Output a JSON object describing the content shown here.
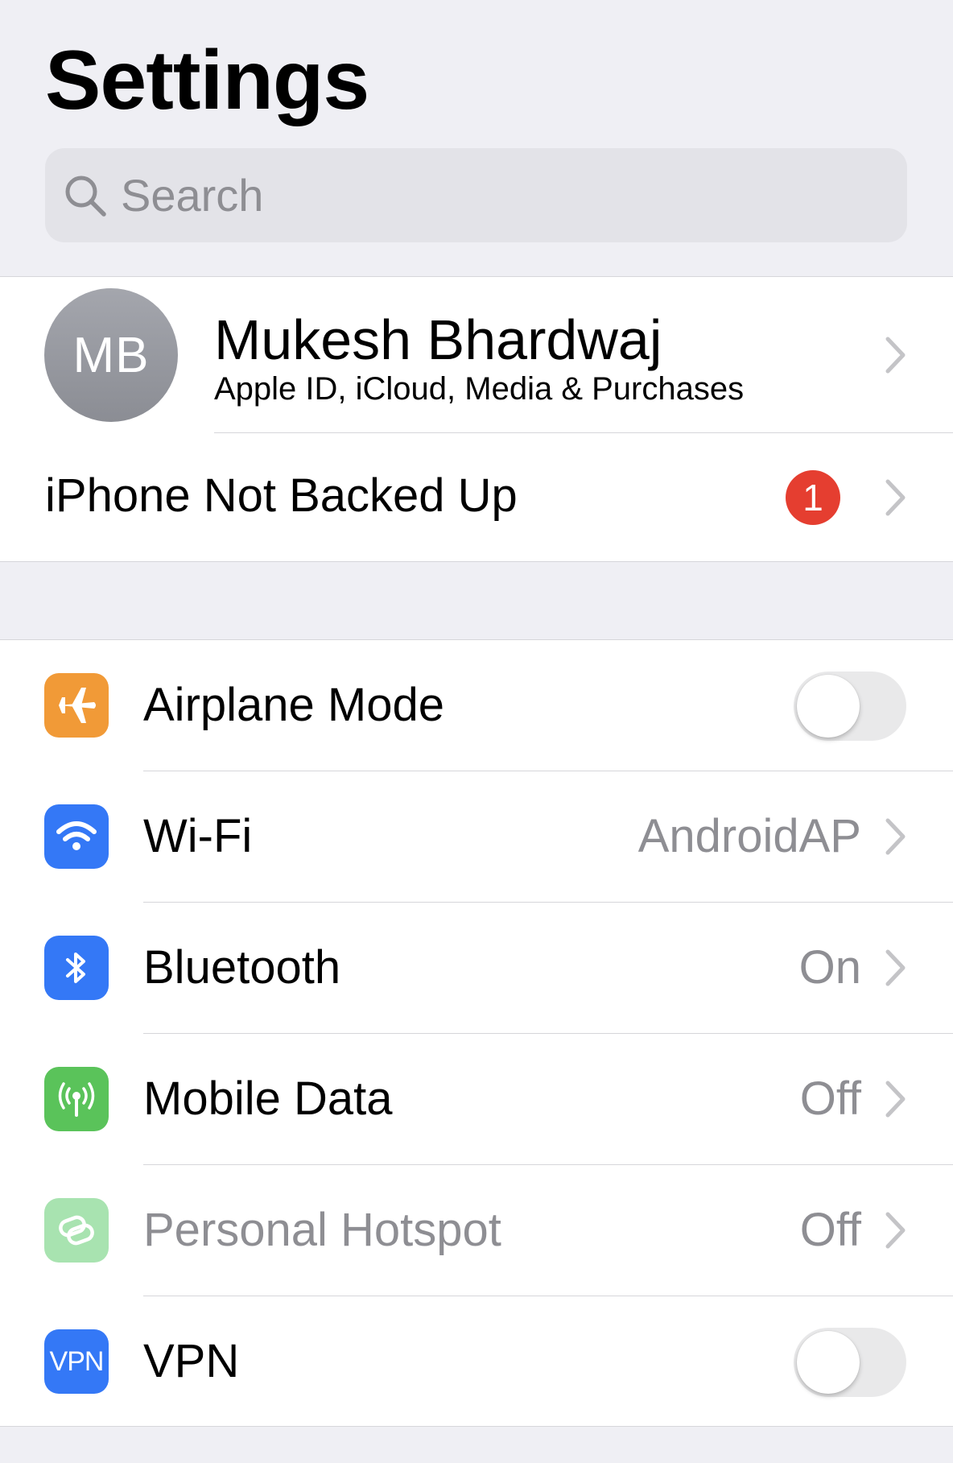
{
  "page": {
    "title": "Settings"
  },
  "search": {
    "placeholder": "Search"
  },
  "profile": {
    "initials": "MB",
    "name": "Mukesh Bhardwaj",
    "subtitle": "Apple ID, iCloud, Media & Purchases"
  },
  "backup": {
    "label": "iPhone Not Backed Up",
    "badge": "1"
  },
  "settings": {
    "airplane": {
      "label": "Airplane Mode",
      "icon": "airplane-icon",
      "icon_color": "#f19a37",
      "toggle_on": false
    },
    "wifi": {
      "label": "Wi-Fi",
      "value": "AndroidAP",
      "icon": "wifi-icon",
      "icon_color": "#3478f6"
    },
    "bluetooth": {
      "label": "Bluetooth",
      "value": "On",
      "icon": "bluetooth-icon",
      "icon_color": "#3478f6"
    },
    "mobile_data": {
      "label": "Mobile Data",
      "value": "Off",
      "icon": "antenna-icon",
      "icon_color": "#5ac35a"
    },
    "hotspot": {
      "label": "Personal Hotspot",
      "value": "Off",
      "icon": "hotspot-icon",
      "icon_color": "#a8e3b0"
    },
    "vpn": {
      "label": "VPN",
      "icon_text": "VPN",
      "icon": "vpn-icon",
      "icon_color": "#3478f6",
      "toggle_on": false
    }
  },
  "colors": {
    "background": "#efeff4",
    "badge": "#e53e30",
    "secondary_text": "#8e8e93"
  }
}
